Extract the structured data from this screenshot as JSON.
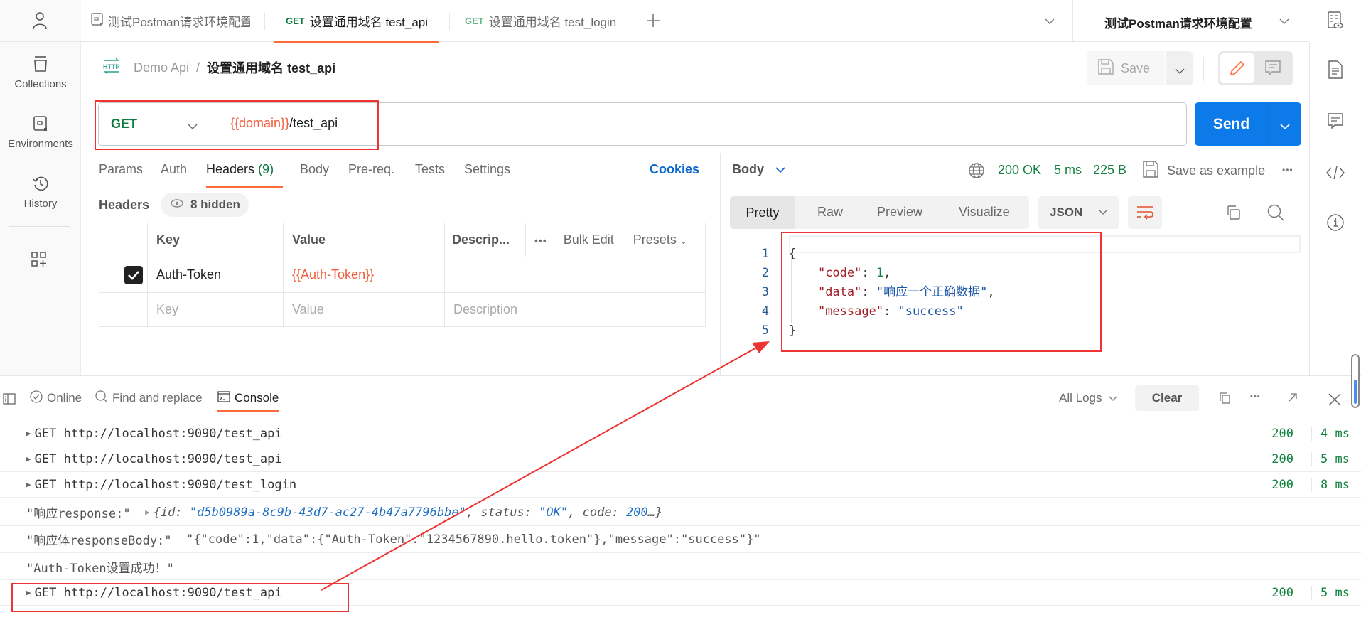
{
  "tabs": {
    "items": [
      {
        "method": "",
        "label": "测试Postman请求环境配置"
      },
      {
        "method": "GET",
        "label": "设置通用域名 test_api"
      },
      {
        "method": "GET",
        "label": "设置通用域名 test_login"
      }
    ],
    "active_index": 1
  },
  "environment": {
    "selected": "测试Postman请求环境配置"
  },
  "sidebar": {
    "items": [
      {
        "label": "Collections",
        "icon": "collections-icon"
      },
      {
        "label": "Environments",
        "icon": "environments-icon"
      },
      {
        "label": "History",
        "icon": "history-icon"
      }
    ]
  },
  "breadcrumb": {
    "badge": "HTTP",
    "collection": "Demo Api",
    "separator": "/",
    "request": "设置通用域名 test_api"
  },
  "toolbar": {
    "save_label": "Save"
  },
  "request": {
    "method": "GET",
    "url_variable": "{{domain}}",
    "url_path": "/test_api",
    "send_label": "Send"
  },
  "request_tabs": {
    "items": [
      "Params",
      "Auth",
      "Headers",
      "Body",
      "Pre-req.",
      "Tests",
      "Settings"
    ],
    "headers_count": "(9)",
    "active": "Headers",
    "cookies_label": "Cookies"
  },
  "headers_section": {
    "title": "Headers",
    "hidden_label": "8 hidden",
    "columns": [
      "Key",
      "Value",
      "Descrip..."
    ],
    "bulk_edit": "Bulk Edit",
    "presets": "Presets",
    "rows": [
      {
        "checked": true,
        "key": "Auth-Token",
        "value": "{{Auth-Token}}",
        "description": ""
      }
    ],
    "placeholder": {
      "key": "Key",
      "value": "Value",
      "description": "Description"
    }
  },
  "response": {
    "body_label": "Body",
    "status": "200 OK",
    "time": "5 ms",
    "size": "225 B",
    "save_example": "Save as example",
    "view_tabs": [
      "Pretty",
      "Raw",
      "Preview",
      "Visualize"
    ],
    "active_view": "Pretty",
    "format": "JSON",
    "code_lines": [
      {
        "n": "1",
        "key": "",
        "val": "",
        "text": "{"
      },
      {
        "n": "2",
        "key": "\"code\"",
        "val": "1",
        "type": "number",
        "trail": ","
      },
      {
        "n": "3",
        "key": "\"data\"",
        "val": "\"响应一个正确数据\"",
        "type": "string",
        "trail": ","
      },
      {
        "n": "4",
        "key": "\"message\"",
        "val": "\"success\"",
        "type": "string",
        "trail": ""
      },
      {
        "n": "5",
        "key": "",
        "val": "",
        "text": "}"
      }
    ]
  },
  "console": {
    "status_online": "Online",
    "find_replace": "Find and replace",
    "console_label": "Console",
    "log_filter": "All Logs",
    "clear_label": "Clear",
    "logs": [
      {
        "type": "request",
        "method": "GET",
        "url": "http://localhost:9090/test_api",
        "status": "200",
        "time": "4 ms"
      },
      {
        "type": "request",
        "method": "GET",
        "url": "http://localhost:9090/test_api",
        "status": "200",
        "time": "5 ms"
      },
      {
        "type": "request",
        "method": "GET",
        "url": "http://localhost:9090/test_login",
        "status": "200",
        "time": "8 ms"
      },
      {
        "type": "object",
        "label": "\"响应response:\"",
        "id_key": "{id: ",
        "id_val": "\"d5b0989a-8c9b-43d7-ac27-4b47a7796bbe\"",
        "status_key": ", status: ",
        "status_val": "\"OK\"",
        "code_key": ", code: ",
        "code_val": "200",
        "tail": "…}"
      },
      {
        "type": "text",
        "label": "\"响应体responseBody:\"",
        "value": "\"{\"code\":1,\"data\":{\"Auth-Token\":\"1234567890.hello.token\"},\"message\":\"success\"}\""
      },
      {
        "type": "text",
        "label": "\"Auth-Token设置成功！\"",
        "value": ""
      },
      {
        "type": "request",
        "method": "GET",
        "url": "http://localhost:9090/test_api",
        "status": "200",
        "time": "5 ms"
      }
    ]
  },
  "colors": {
    "accent": "#ff6c37",
    "send": "#0c7ae8",
    "success": "#12823f",
    "variable": "#f05d3a",
    "annotation": "#ee3333"
  }
}
